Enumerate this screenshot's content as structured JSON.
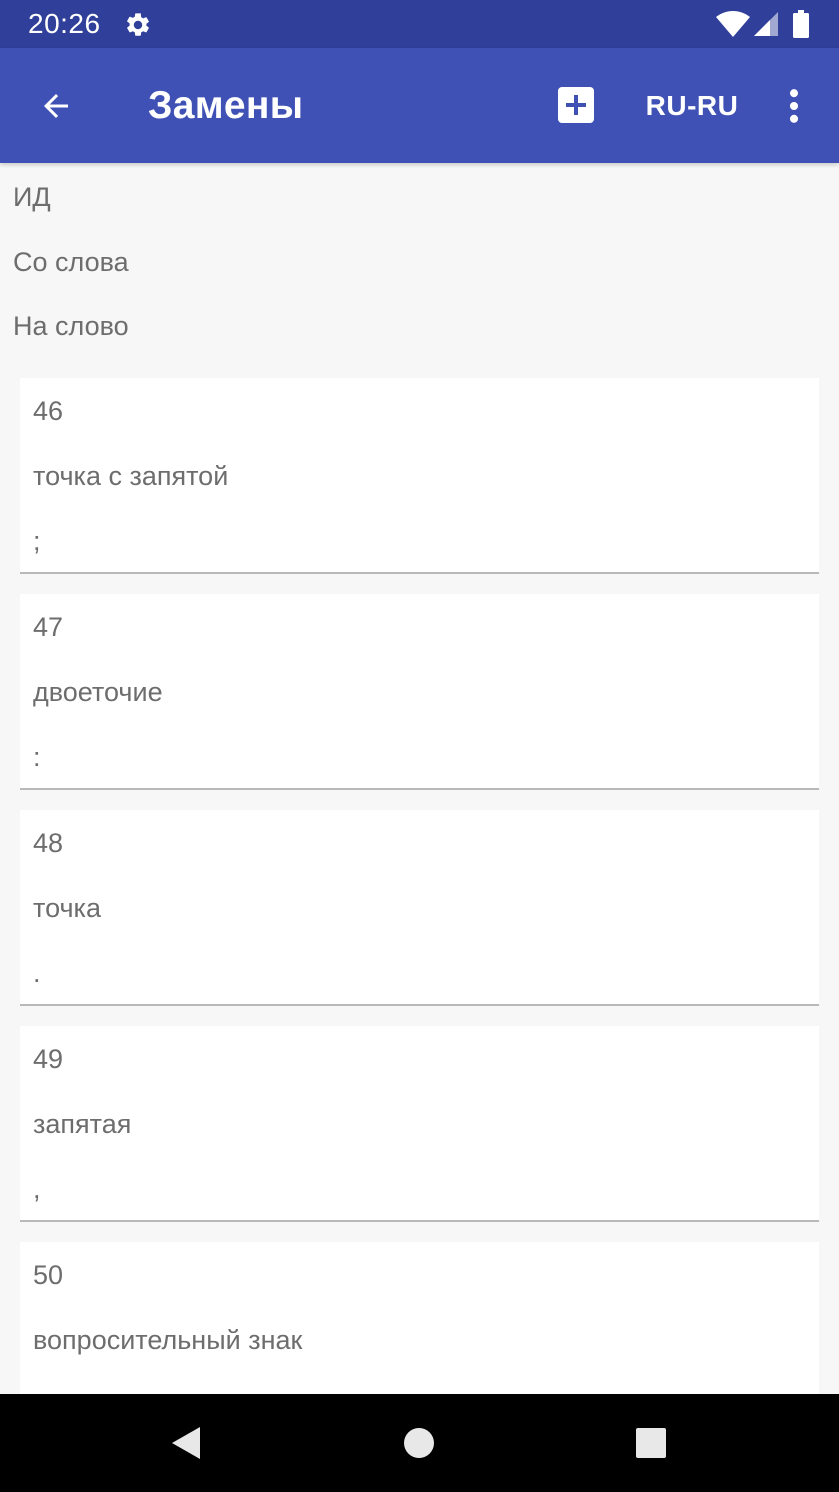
{
  "status_bar": {
    "time": "20:26",
    "icons": [
      "gear-icon",
      "wifi-icon",
      "signal-icon",
      "battery-icon"
    ],
    "color": "#2f3f9a"
  },
  "app_bar": {
    "title": "Замены",
    "language": "RU-RU",
    "color": "#3f51b5",
    "icons": [
      "arrow-left-icon",
      "add-box-icon",
      "more-vert-icon"
    ]
  },
  "header": {
    "id_label": "ИД",
    "from_label": "Со слова",
    "to_label": "На слово"
  },
  "items": [
    {
      "id": "46",
      "from": "точка с запятой",
      "to": ";"
    },
    {
      "id": "47",
      "from": "двоеточие",
      "to": ":"
    },
    {
      "id": "48",
      "from": "точка",
      "to": "."
    },
    {
      "id": "49",
      "from": "запятая",
      "to": ","
    },
    {
      "id": "50",
      "from": "вопросительный знак",
      "to": ""
    }
  ],
  "nav_bar": {
    "icons": [
      "nav-back-icon",
      "nav-home-icon",
      "nav-recent-icon"
    ]
  }
}
